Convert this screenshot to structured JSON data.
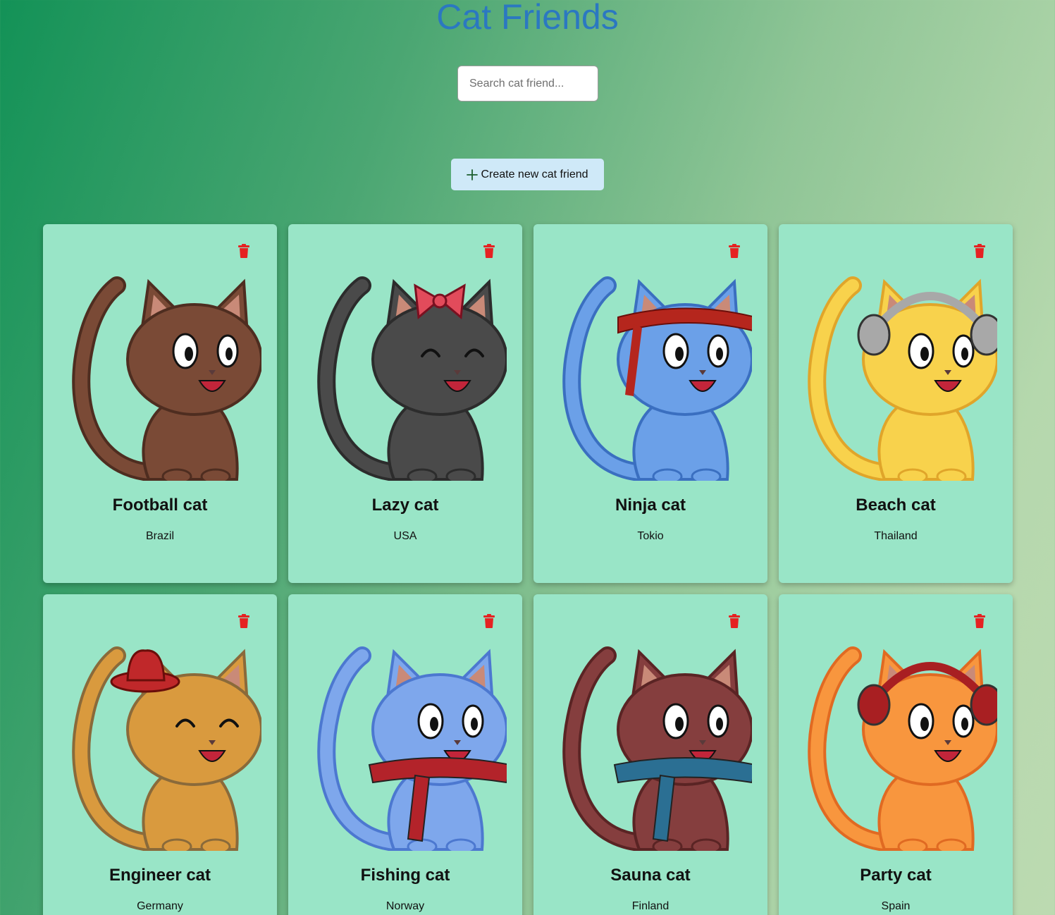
{
  "header": {
    "title": "Cat Friends"
  },
  "search": {
    "placeholder": "Search cat friend...",
    "value": ""
  },
  "toolbar": {
    "create_label": "Create new cat friend"
  },
  "colors": {
    "title": "#2b78c1",
    "card_bg": "#99e5c7",
    "trash": "#e52222",
    "create_bg": "#cfe9f8"
  },
  "cats": [
    {
      "name": "Football cat",
      "country": "Brazil",
      "fur": "#7a4a36",
      "dark": "#4e2d20",
      "accent": "#9a9a92",
      "accessory": "none",
      "eyes": "open"
    },
    {
      "name": "Lazy cat",
      "country": "USA",
      "fur": "#4a4a4a",
      "dark": "#2c2c2c",
      "accent": "#e24b5b",
      "accessory": "bow",
      "eyes": "happy"
    },
    {
      "name": "Ninja cat",
      "country": "Tokio",
      "fur": "#6ba0e8",
      "dark": "#3a6fc0",
      "accent": "#b5261d",
      "accessory": "headband",
      "eyes": "open"
    },
    {
      "name": "Beach cat",
      "country": "Thailand",
      "fur": "#f8d24c",
      "dark": "#e0a52a",
      "accent": "#a8a8a8",
      "accessory": "headphones",
      "eyes": "open"
    },
    {
      "name": "Engineer cat",
      "country": "Germany",
      "fur": "#d99a3e",
      "dark": "#8a6a3a",
      "accent": "#c0282a",
      "accessory": "hat",
      "eyes": "happy"
    },
    {
      "name": "Fishing cat",
      "country": "Norway",
      "fur": "#7ea7ec",
      "dark": "#4c78d0",
      "accent": "#b3232a",
      "accessory": "scarf",
      "eyes": "open"
    },
    {
      "name": "Sauna cat",
      "country": "Finland",
      "fur": "#853e3e",
      "dark": "#5a2424",
      "accent": "#2b6f93",
      "accessory": "scarf",
      "eyes": "open"
    },
    {
      "name": "Party cat",
      "country": "Spain",
      "fur": "#f8963e",
      "dark": "#e06a22",
      "accent": "#a81f22",
      "accessory": "headphones",
      "eyes": "open"
    }
  ]
}
